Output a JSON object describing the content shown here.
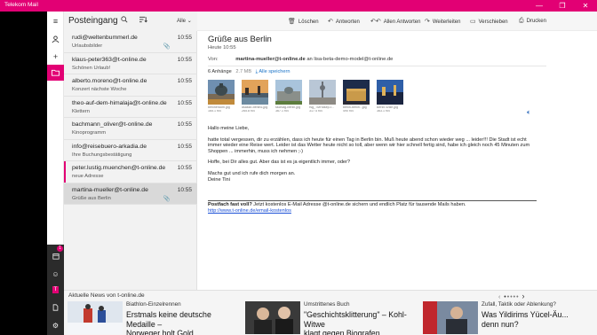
{
  "window": {
    "title": "Telekom Mail",
    "minimize": "—",
    "maximize": "❐",
    "close": "✕"
  },
  "rail": {
    "menu_icon": "hamburger-icon",
    "account_icon": "person-icon",
    "compose_icon": "plus-icon",
    "folder_icon": "folder-icon",
    "badge": "1"
  },
  "list": {
    "folder": "Posteingang",
    "filter": "Alle",
    "items": [
      {
        "from": "rudi@weltenbummerl.de",
        "time": "10:55",
        "subject": "Urlaubsbilder",
        "attachment": true
      },
      {
        "from": "klaus-peter363@t-online.de",
        "time": "10:55",
        "subject": "Schönen Urlaub!",
        "attachment": false
      },
      {
        "from": "alberto.moreno@t-online.de",
        "time": "10:55",
        "subject": "Konzert nächste Woche",
        "attachment": false
      },
      {
        "from": "theo-auf-dem-himalaja@t-online.de",
        "time": "10:55",
        "subject": "Klettern",
        "attachment": false
      },
      {
        "from": "bachmann_oliver@t-online.de",
        "time": "10:55",
        "subject": "Kinoprogramm",
        "attachment": false
      },
      {
        "from": "info@reisebuero-arkadia.de",
        "time": "10:55",
        "subject": "Ihre Buchungsbestätigung",
        "attachment": false
      },
      {
        "from": "peter.lustig.muenchen@t-online.de",
        "time": "10:55",
        "subject": "neue Adresse",
        "attachment": false
      },
      {
        "from": "martina-mueller@t-online.de",
        "time": "10:55",
        "subject": "Grüße aus Berlin",
        "attachment": true
      }
    ]
  },
  "toolbar": {
    "delete": "Löschen",
    "reply": "Antworten",
    "reply_all": "Allen Antworten",
    "forward": "Weiterleiten",
    "move": "Verschieben",
    "print": "Drucken"
  },
  "mail": {
    "subject": "Grüße aus Berlin",
    "date": "Heute 10:55",
    "from_label": "Von:",
    "from": "martina-mueller@t-online.de",
    "to_text": "an lisa-beta-demo-model@t-online.de",
    "attachments_count": "6 Anhänge",
    "attachments_size": "2.7 MB",
    "save_all": "Alle speichern",
    "attachments": [
      {
        "name": "berlinerdom.jpg",
        "size": "165.1 KB"
      },
      {
        "name": "dsaskb-berlin5.jpg",
        "size": "265.8 KB"
      },
      {
        "name": "sschlag-berlin.jpg",
        "size": "367.1 KB"
      },
      {
        "name": "rsg_TMHdsep-t...",
        "size": "317.4 KB"
      },
      {
        "name": "berlin-berlin...jpg",
        "size": "490 KB"
      },
      {
        "name": "Berlin-Wille.jpg",
        "size": "363.1 KB"
      }
    ],
    "greeting": "Hallo meine Liebe,",
    "body": "hatte total vergessen, dir zu erzählen, dass ich heute für einen Tag in Berlin bin. Muß heute abend schon wieder weg ... leider!!! Die Stadt ist echt immer wieder eine Reise wert. Leider ist das Wetter heute nicht so toll, aber wenn wir hier schnell fertig sind, habe ich gleich noch 45 Minuten zum Shoppen ... immerhin, muss ich nehmen ;-)",
    "para2": "Hoffe, bei Dir alles gut. Aber das ist es ja eigentlich immer, oder?",
    "para3": "Machs gut und ich rufe dich morgen an.\nDeine Tini",
    "sig_bold": "Postfach fast voll?",
    "sig_text": " Jetzt kostenlos E-Mail Adresse @t-online.de sichern und endlich Platz für tausende Mails haben.",
    "sig_link": "http://www.t-online.de/email-kostenlos"
  },
  "news": {
    "header": "Aktuelle News von t-online.de",
    "items": [
      {
        "category": "Biathlon-Einzelrennen",
        "headline": "Erstmals keine deutsche Medaille –\nNorweger holt Gold"
      },
      {
        "category": "Umstrittenes Buch",
        "headline": "\"Geschichtsklitterung\" – Kohl-Witwe\nklagt gegen Biografen"
      },
      {
        "category": "Zufall, Taktik oder Ablenkung?",
        "headline": "Was Yildirims Yücel-Äu...\ndenn nun?"
      }
    ]
  },
  "colors": {
    "brand": "#e20074",
    "link": "#1a4fd6"
  }
}
